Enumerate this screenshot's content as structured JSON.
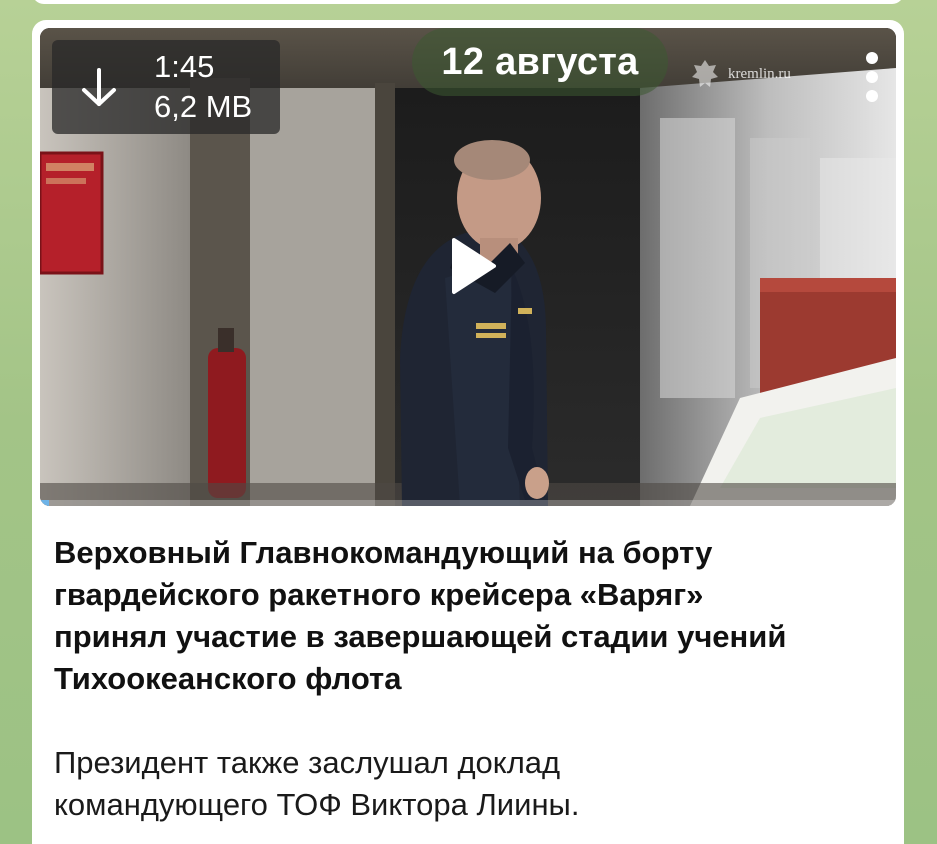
{
  "message": {
    "video": {
      "duration": "1:45",
      "file_size": "6,2 MB",
      "date_label": "12 августа",
      "watermark_text": "kremlin.ru",
      "progress_fraction": 0.01,
      "download_icon": "arrow-down-icon",
      "play_icon": "play-icon",
      "menu_icon": "vertical-dots-icon"
    },
    "caption": {
      "title_lines": [
        "Верховный Главнокомандующий на борту",
        "гвардейского ракетного крейсера «Варяг»",
        "принял участие в завершающей стадии учений",
        "Тихоокеанского флота"
      ],
      "body_lines": [
        "Президент также заслушал доклад",
        "командующего ТОФ Виктора Лиины."
      ]
    }
  },
  "colors": {
    "chat_background": "#a9c98c",
    "bubble": "#ffffff",
    "progress": "#6db3e8",
    "text": "#111111"
  }
}
